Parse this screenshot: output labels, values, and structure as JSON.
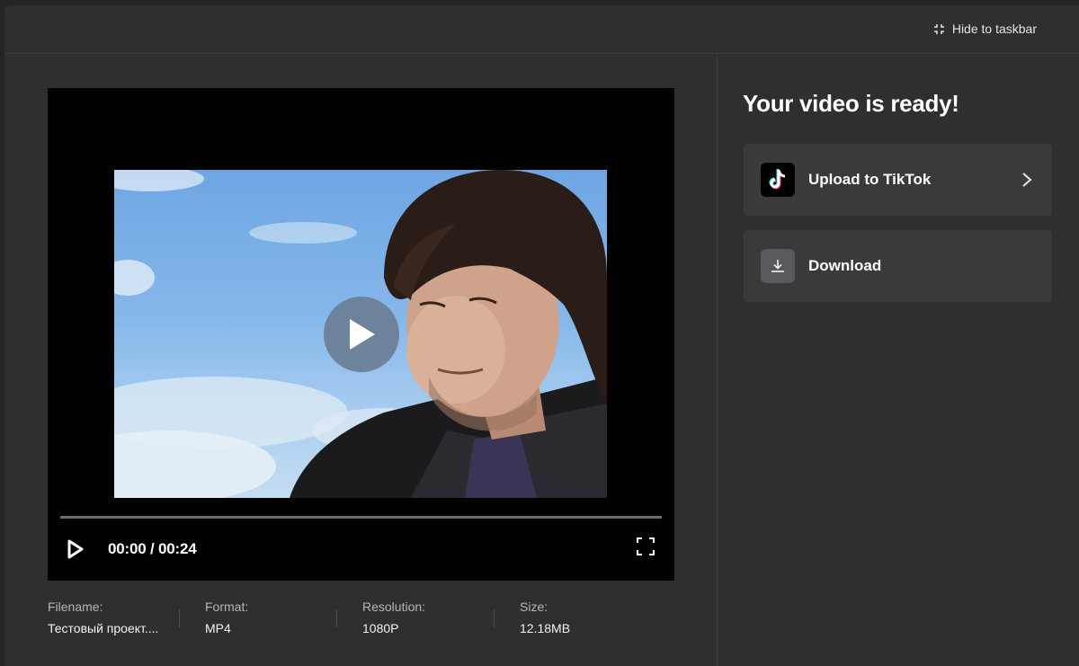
{
  "header": {
    "hide_label": "Hide to taskbar",
    "hide_icon": "shrink-icon"
  },
  "player": {
    "time_display": "00:00 / 00:24",
    "play_icon": "play-icon",
    "fullscreen_icon": "fullscreen-icon",
    "progress": 0
  },
  "meta": {
    "filename_label": "Filename:",
    "filename_value": "Тестовый проект....",
    "format_label": "Format:",
    "format_value": "MP4",
    "resolution_label": "Resolution:",
    "resolution_value": "1080P",
    "size_label": "Size:",
    "size_value": "12.18MB"
  },
  "panel": {
    "title": "Your video is ready!",
    "actions": [
      {
        "label": "Upload to TikTok",
        "icon": "tiktok-icon",
        "has_chevron": true
      },
      {
        "label": "Download",
        "icon": "download-icon",
        "has_chevron": false
      }
    ]
  },
  "colors": {
    "modal_bg": "#2f2f31",
    "action_bg": "#3a3a3d",
    "play_overlay": "#697d91"
  }
}
